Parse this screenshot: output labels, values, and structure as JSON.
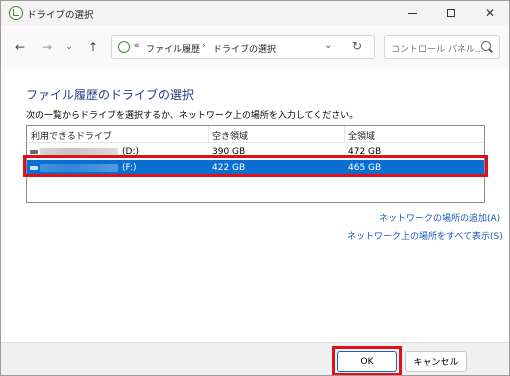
{
  "window": {
    "title": "ドライブの選択",
    "controls": {
      "minimize": "",
      "maximize": "",
      "close": "✕"
    }
  },
  "nav": {
    "back": "←",
    "forward": "→",
    "dropdown": "⌄",
    "up": "↑",
    "address": {
      "overflow": "«",
      "segment1": "ファイル履歴",
      "separator": "›",
      "segment2": "ドライブの選択",
      "chevron": "⌄",
      "refresh": "↻"
    },
    "search": {
      "placeholder": "コントロール パネル..."
    }
  },
  "content": {
    "heading": "ファイル履歴のドライブの選択",
    "description": "次の一覧からドライブを選択するか、ネットワーク上の場所を入力してください。",
    "columns": [
      "利用できるドライブ",
      "空き領域",
      "全領域"
    ],
    "rows": [
      {
        "drive": "(D:)",
        "free": "390 GB",
        "total": "472 GB",
        "selected": false
      },
      {
        "drive": "(F:)",
        "free": "422 GB",
        "total": "465 GB",
        "selected": true
      }
    ],
    "links": {
      "add_network": "ネットワークの場所の追加(A)",
      "show_all_network": "ネットワーク上の場所をすべて表示(S)"
    }
  },
  "buttons": {
    "ok": "OK",
    "cancel": "キャンセル"
  },
  "colors": {
    "selection": "#0a6fd1",
    "highlight": "#e0101a",
    "heading": "#1f3f8a",
    "link": "#1857b8"
  }
}
